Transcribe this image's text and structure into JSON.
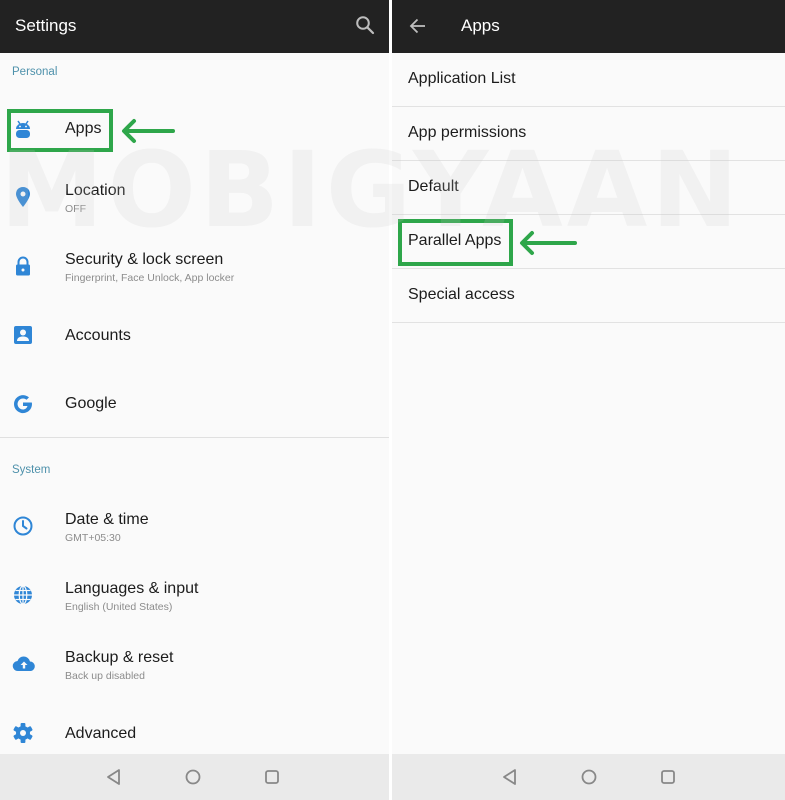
{
  "colors": {
    "appbar_bg": "#222222",
    "icon_blue": "#2f86d6",
    "section_label": "#4e91ab",
    "highlight_green": "#2ea64a",
    "navbar_bg": "#eaeaea"
  },
  "watermark": "MOBIGYAAN",
  "left": {
    "title": "Settings",
    "search_icon": "search-icon",
    "sections": [
      {
        "label": "Personal",
        "items": [
          {
            "label": "Apps",
            "sub": "",
            "icon": "android-icon",
            "highlighted": true
          },
          {
            "label": "Location",
            "sub": "OFF",
            "icon": "location-pin-icon"
          },
          {
            "label": "Security & lock screen",
            "sub": "Fingerprint, Face Unlock, App locker",
            "icon": "lock-icon"
          },
          {
            "label": "Accounts",
            "sub": "",
            "icon": "account-box-icon"
          },
          {
            "label": "Google",
            "sub": "",
            "icon": "google-g-icon"
          }
        ]
      },
      {
        "label": "System",
        "items": [
          {
            "label": "Date & time",
            "sub": "GMT+05:30",
            "icon": "clock-icon"
          },
          {
            "label": "Languages & input",
            "sub": "English (United States)",
            "icon": "globe-icon"
          },
          {
            "label": "Backup & reset",
            "sub": "Back up disabled",
            "icon": "cloud-upload-icon"
          },
          {
            "label": "Advanced",
            "sub": "",
            "icon": "gear-icon"
          }
        ]
      }
    ]
  },
  "right": {
    "title": "Apps",
    "back_icon": "arrow-back-icon",
    "items": [
      {
        "label": "Application List"
      },
      {
        "label": "App permissions"
      },
      {
        "label": "Default"
      },
      {
        "label": "Parallel Apps",
        "highlighted": true
      },
      {
        "label": "Special access"
      }
    ]
  },
  "navbar": {
    "buttons": [
      "back-nav-icon",
      "home-nav-icon",
      "recents-nav-icon"
    ]
  }
}
